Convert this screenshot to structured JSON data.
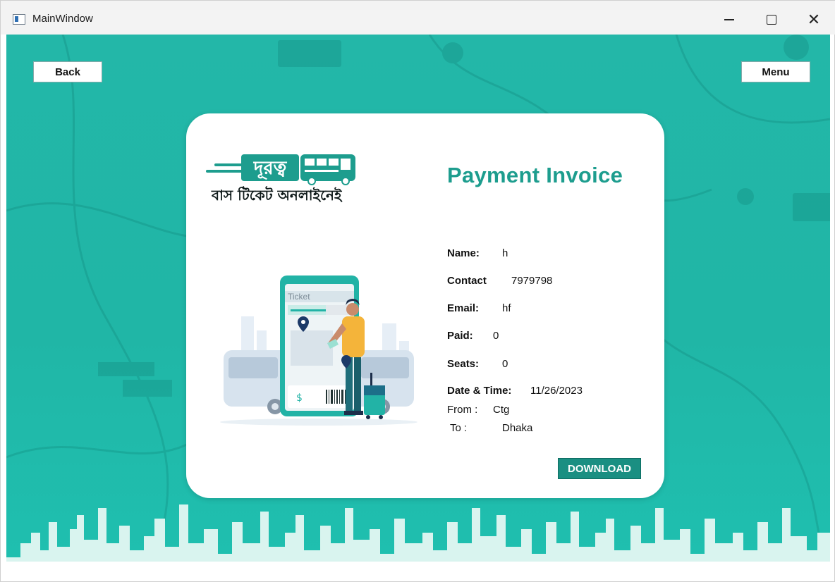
{
  "window": {
    "title": "MainWindow",
    "minimize_icon": "minimize-icon",
    "maximize_icon": "maximize-icon",
    "close_icon": "close-icon"
  },
  "nav": {
    "back_label": "Back",
    "menu_label": "Menu"
  },
  "brand": {
    "logo_word": "দূরত্ব",
    "tagline": "বাস টিকেট অনলাইনেই",
    "accent": "#1d9d8e"
  },
  "invoice": {
    "heading": "Payment Invoice",
    "ticket_text": "Ticket",
    "fields": {
      "name_label": "Name:",
      "name_value": "h",
      "contact_label": "Contact",
      "contact_value": "7979798",
      "email_label": "Email:",
      "email_value": "hf",
      "paid_label": "Paid:",
      "paid_value": "0",
      "seats_label": "Seats:",
      "seats_value": "0",
      "datetime_label": "Date & Time:",
      "datetime_value": "11/26/2023",
      "from_label": "From :",
      "from_value": "Ctg",
      "to_label": "To :",
      "to_value": "Dhaka"
    },
    "download_label": "DOWNLOAD"
  },
  "colors": {
    "background": "#23b7a8",
    "card": "#ffffff",
    "button": "#1a8f82"
  }
}
